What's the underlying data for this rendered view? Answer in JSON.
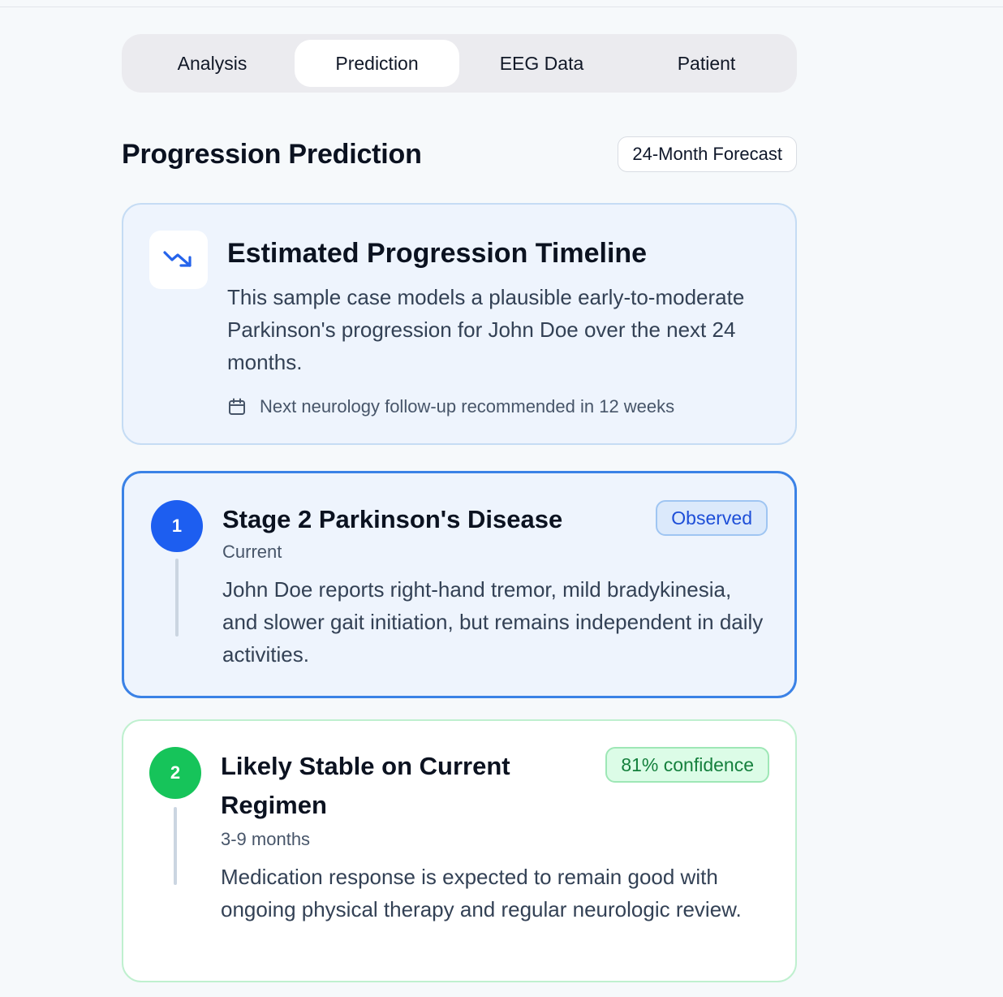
{
  "tabs": [
    {
      "label": "Analysis",
      "active": false
    },
    {
      "label": "Prediction",
      "active": true
    },
    {
      "label": "EEG Data",
      "active": false
    },
    {
      "label": "Patient",
      "active": false
    }
  ],
  "header": {
    "title": "Progression Prediction",
    "badge": "24-Month Forecast"
  },
  "summary": {
    "icon": "trending-down-icon",
    "title": "Estimated Progression Timeline",
    "text": "This sample case models a plausible early-to-moderate Parkinson's progression for John Doe over the next 24 months.",
    "followup_icon": "calendar-icon",
    "followup": "Next neurology follow-up recommended in 12 weeks"
  },
  "stages": [
    {
      "number": "1",
      "title": "Stage 2 Parkinson's Disease",
      "timeframe": "Current",
      "description": "John Doe reports right-hand tremor, mild bradykinesia, and slower gait initiation, but remains independent in daily activities.",
      "badge": "Observed",
      "color": "#1d5ef0"
    },
    {
      "number": "2",
      "title": "Likely Stable on Current Regimen",
      "timeframe": "3-9 months",
      "description": "Medication response is expected to remain good with ongoing physical therapy and regular neurologic review.",
      "badge": "81% confidence",
      "color": "#16c45a"
    }
  ]
}
